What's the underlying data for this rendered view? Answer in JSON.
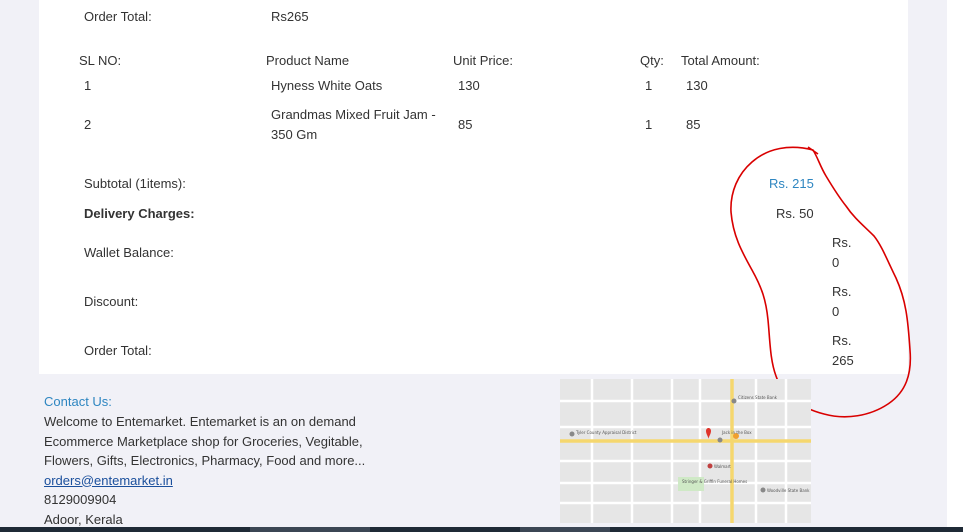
{
  "order_summary": {
    "label": "Order Total:",
    "value": "Rs265"
  },
  "table": {
    "headers": {
      "sl": "SL NO:",
      "product": "Product Name",
      "unit_price": "Unit Price:",
      "qty": "Qty:",
      "total": "Total Amount:"
    },
    "rows": [
      {
        "sl": "1",
        "product_line1": "Hyness White Oats",
        "product_line2": "",
        "unit_price": "130",
        "qty": "1",
        "total": "130"
      },
      {
        "sl": "2",
        "product_line1": "Grandmas Mixed Fruit Jam -",
        "product_line2": "350 Gm",
        "unit_price": "85",
        "qty": "1",
        "total": "85"
      }
    ]
  },
  "totals": {
    "subtotal_label": "Subtotal (1items):",
    "subtotal_value": "Rs. 215",
    "delivery_label": "Delivery Charges:",
    "delivery_value": "Rs. 50",
    "wallet_label": "Wallet Balance:",
    "wallet_value_1": "Rs.",
    "wallet_value_2": "0",
    "discount_label": "Discount:",
    "discount_value_1": "Rs.",
    "discount_value_2": "0",
    "order_total_label": "Order Total:",
    "order_total_value_1": "Rs.",
    "order_total_value_2": "265"
  },
  "footer": {
    "contact_title": "Contact Us:",
    "welcome_line1": "Welcome to Entemarket. Entemarket is an on demand",
    "welcome_line2": "Ecommerce Marketplace shop for Groceries, Vegitable,",
    "welcome_line3": "Flowers, Gifts, Electronics, Pharmacy, Food and more...",
    "email": "orders@entemarket.in",
    "phone": "8129009904",
    "address": "Adoor, Kerala"
  },
  "map": {
    "label_county": "Tyler County\nAppraisal District",
    "label_bank": "Citizens State Bank",
    "label_cafe": "Jack in the Box",
    "label_store": "Walmart",
    "label_funeral": "Stringer & Griffin\nFuneral Homes",
    "label_bank2": "Woodville State Bank"
  },
  "annotation": {
    "color": "#d90000"
  },
  "colors": {
    "accent": "#2e86c1",
    "panel": "#ffffff",
    "background": "#f1f1f7"
  }
}
